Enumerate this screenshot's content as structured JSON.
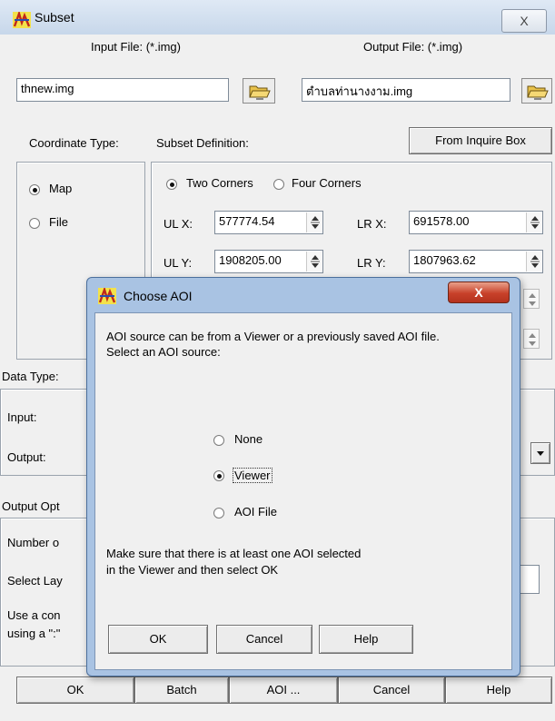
{
  "window": {
    "title": "Subset",
    "close_symbol": "X"
  },
  "files": {
    "input_label": "Input File: (*.img)",
    "input_value": "thnew.img",
    "output_label": "Output File: (*.img)",
    "output_value": "ตำบลท่านางงาม.img"
  },
  "coordinate_type": {
    "label": "Coordinate Type:",
    "options": [
      "Map",
      "File"
    ],
    "selected": "Map"
  },
  "subset_definition": {
    "label": "Subset Definition:",
    "inquire_button": "From Inquire Box",
    "corner_options": [
      "Two Corners",
      "Four Corners"
    ],
    "selected": "Two Corners",
    "ulx_label": "UL X:",
    "ulx_value": "577774.54",
    "lrx_label": "LR X:",
    "lrx_value": "691578.00",
    "uly_label": "UL Y:",
    "uly_value": "1908205.00",
    "lry_label": "LR Y:",
    "lry_value": "1807963.62"
  },
  "data_type": {
    "label": "Data Type:",
    "input_label": "Input:",
    "output_label": "Output:"
  },
  "output_options": {
    "label": "Output Opt",
    "number_label": "Number o",
    "select_layers_label": "Select Lay",
    "use_comma_label": "Use a con",
    "using_label": "using a \":\""
  },
  "bottom_buttons": [
    "OK",
    "Batch",
    "AOI ...",
    "Cancel",
    "Help"
  ],
  "aoi_dialog": {
    "title": "Choose AOI",
    "close_symbol": "X",
    "intro_line1": "AOI source can be from a Viewer or a previously saved AOI file.",
    "intro_line2": "Select an AOI source:",
    "options": [
      "None",
      "Viewer",
      "AOI File"
    ],
    "selected": "Viewer",
    "note_line1": "Make sure that there is at least one AOI selected",
    "note_line2": "in the Viewer and then select OK",
    "ok_label": "OK",
    "cancel_label": "Cancel",
    "help_label": "Help"
  }
}
